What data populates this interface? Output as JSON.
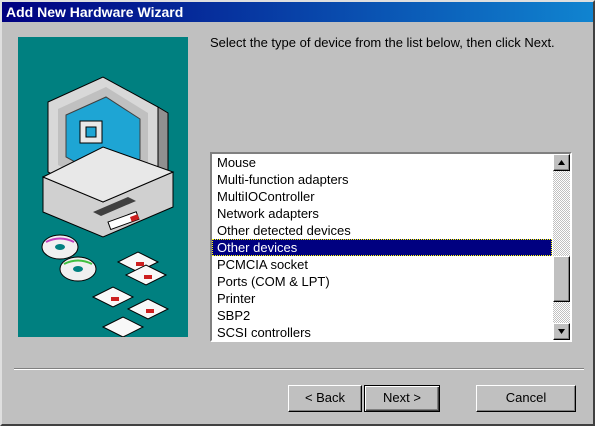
{
  "window": {
    "title": "Add New Hardware Wizard"
  },
  "instruction": "Select the type of device from the list below, then click Next.",
  "device_list": {
    "items": [
      "Mouse",
      "Multi-function adapters",
      "MultiIOController",
      "Network adapters",
      "Other detected devices",
      "Other devices",
      "PCMCIA socket",
      "Ports (COM & LPT)",
      "Printer",
      "SBP2",
      "SCSI controllers"
    ],
    "selected": "Other devices"
  },
  "buttons": {
    "back": "< Back",
    "next": "Next >",
    "cancel": "Cancel"
  },
  "icons": {
    "scroll_up": "arrow-up-icon",
    "scroll_down": "arrow-down-icon",
    "illustration": "computer-with-disks-illustration"
  },
  "colors": {
    "titlebar": "#000080",
    "selection": "#000080",
    "panel": "#008080",
    "face": "#c0c0c0"
  }
}
